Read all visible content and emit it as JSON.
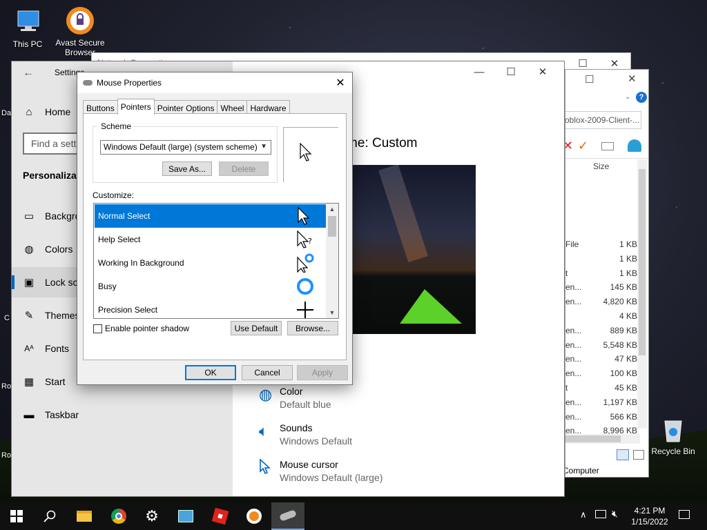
{
  "desktop": {
    "icons": [
      {
        "label": "This PC"
      },
      {
        "label": "Avast Secure Browser"
      },
      {
        "label": "Recycle Bin"
      }
    ],
    "edge_labels": [
      "Da",
      "C",
      "Ro",
      "Ro"
    ]
  },
  "network_window": {
    "title": "Network Connections"
  },
  "settings": {
    "title": "Settings",
    "home": "Home",
    "search_placeholder": "Find a setting",
    "section": "Personalization",
    "nav": [
      "Background",
      "Colors",
      "Lock screen",
      "Themes",
      "Fonts",
      "Start",
      "Taskbar"
    ],
    "theme_title": "Current theme: Custom",
    "rows": [
      {
        "title": "Color",
        "value": "Default blue"
      },
      {
        "title": "Sounds",
        "value": "Windows Default"
      },
      {
        "title": "Mouse cursor",
        "value": "Windows Default (large)"
      }
    ]
  },
  "explorer": {
    "address": "oblox-2009-Client-...",
    "col_size": "Size",
    "rows": [
      {
        "type": "File",
        "size": "1 KB"
      },
      {
        "type": "",
        "size": "1 KB"
      },
      {
        "type": "t",
        "size": "1 KB"
      },
      {
        "type": "en...",
        "size": "145 KB"
      },
      {
        "type": "en...",
        "size": "4,820 KB"
      },
      {
        "type": "",
        "size": "4 KB"
      },
      {
        "type": "en...",
        "size": "889 KB"
      },
      {
        "type": "en...",
        "size": "5,548 KB"
      },
      {
        "type": "en...",
        "size": "47 KB"
      },
      {
        "type": "en...",
        "size": "100 KB"
      },
      {
        "type": "t",
        "size": "45 KB"
      },
      {
        "type": "en...",
        "size": "1,197 KB"
      },
      {
        "type": "en...",
        "size": "566 KB"
      },
      {
        "type": "en...",
        "size": "8,996 KB"
      }
    ],
    "status": "Computer"
  },
  "dialog": {
    "title": "Mouse Properties",
    "tabs": [
      "Buttons",
      "Pointers",
      "Pointer Options",
      "Wheel",
      "Hardware"
    ],
    "scheme_label": "Scheme",
    "scheme_value": "Windows Default (large) (system scheme)",
    "save_as": "Save As...",
    "delete": "Delete",
    "customize_label": "Customize:",
    "cursors": [
      "Normal Select",
      "Help Select",
      "Working In Background",
      "Busy",
      "Precision Select"
    ],
    "shadow_label": "Enable pointer shadow",
    "use_default": "Use Default",
    "browse": "Browse...",
    "ok": "OK",
    "cancel": "Cancel",
    "apply": "Apply"
  },
  "taskbar": {
    "time": "4:21 PM",
    "date": "1/15/2022"
  },
  "colors": {
    "accent": "#0078d7",
    "settings_accent": "#0067c0"
  }
}
